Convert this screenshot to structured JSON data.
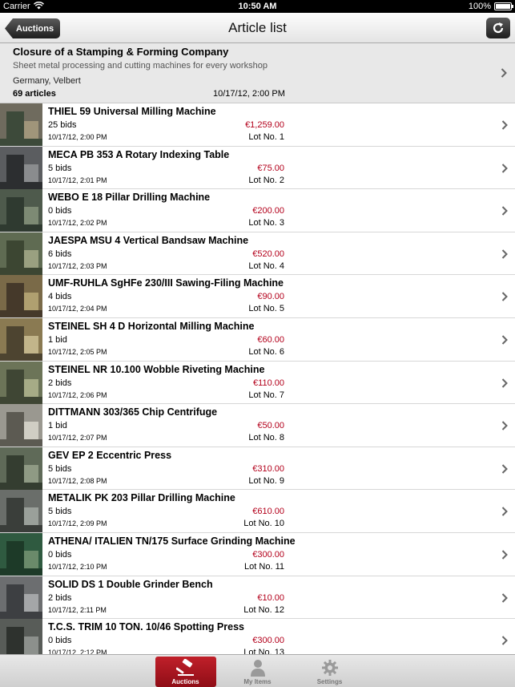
{
  "status_bar": {
    "carrier": "Carrier",
    "time": "10:50 AM",
    "battery": "100%"
  },
  "nav": {
    "title": "Article list",
    "back_label": "Auctions",
    "refresh_icon": "refresh-icon"
  },
  "auction": {
    "title": "Closure of a Stamping & Forming Company",
    "subtitle": "Sheet metal processing and cutting machines for every workshop",
    "location": "Germany, Velbert",
    "count": "69 articles",
    "date": "10/17/12, 2:00 PM"
  },
  "items": [
    {
      "title": "THIEL 59 Universal Milling Machine",
      "bids": "25 bids",
      "date": "10/17/12, 2:00 PM",
      "price": "€1,259.00",
      "lot": "Lot No. 1"
    },
    {
      "title": "MECA PB 353 A Rotary Indexing Table",
      "bids": "5 bids",
      "date": "10/17/12, 2:01 PM",
      "price": "€75.00",
      "lot": "Lot No. 2"
    },
    {
      "title": "WEBO E 18 Pillar Drilling Machine",
      "bids": "0 bids",
      "date": "10/17/12, 2:02 PM",
      "price": "€200.00",
      "lot": "Lot No. 3"
    },
    {
      "title": "JAESPA MSU 4 Vertical Bandsaw Machine",
      "bids": "6 bids",
      "date": "10/17/12, 2:03 PM",
      "price": "€520.00",
      "lot": "Lot No. 4"
    },
    {
      "title": "UMF-RUHLA SgHFe 230/III Sawing-Filing Machine",
      "bids": "4 bids",
      "date": "10/17/12, 2:04 PM",
      "price": "€90.00",
      "lot": "Lot No. 5"
    },
    {
      "title": "STEINEL SH 4 D Horizontal Milling Machine",
      "bids": "1 bid",
      "date": "10/17/12, 2:05 PM",
      "price": "€60.00",
      "lot": "Lot No. 6"
    },
    {
      "title": "STEINEL NR 10.100 Wobble Riveting Machine",
      "bids": "2 bids",
      "date": "10/17/12, 2:06 PM",
      "price": "€110.00",
      "lot": "Lot No. 7"
    },
    {
      "title": "DITTMANN 303/365 Chip Centrifuge",
      "bids": "1 bid",
      "date": "10/17/12, 2:07 PM",
      "price": "€50.00",
      "lot": "Lot No. 8"
    },
    {
      "title": "GEV EP 2 Eccentric Press",
      "bids": "5 bids",
      "date": "10/17/12, 2:08 PM",
      "price": "€310.00",
      "lot": "Lot No. 9"
    },
    {
      "title": "METALIK PK 203 Pillar Drilling Machine",
      "bids": "5 bids",
      "date": "10/17/12, 2:09 PM",
      "price": "€610.00",
      "lot": "Lot No. 10"
    },
    {
      "title": "ATHENA/ ITALIEN TN/175 Surface Grinding Machine",
      "bids": "0 bids",
      "date": "10/17/12, 2:10 PM",
      "price": "€300.00",
      "lot": "Lot No. 11"
    },
    {
      "title": "SOLID DS 1 Double Grinder Bench",
      "bids": "2 bids",
      "date": "10/17/12, 2:11 PM",
      "price": "€10.00",
      "lot": "Lot No. 12"
    },
    {
      "title": "T.C.S. TRIM 10 TON. 10/46 Spotting Press",
      "bids": "0 bids",
      "date": "10/17/12, 2:12 PM",
      "price": "€300.00",
      "lot": "Lot No. 13"
    }
  ],
  "tabs": [
    {
      "label": "Auctions",
      "icon": "gavel-icon",
      "active": true
    },
    {
      "label": "My Items",
      "icon": "person-icon",
      "active": false
    },
    {
      "label": "Settings",
      "icon": "gear-icon",
      "active": false
    }
  ],
  "colors": {
    "price": "#b3001b",
    "tab_active": "#a8141e"
  }
}
